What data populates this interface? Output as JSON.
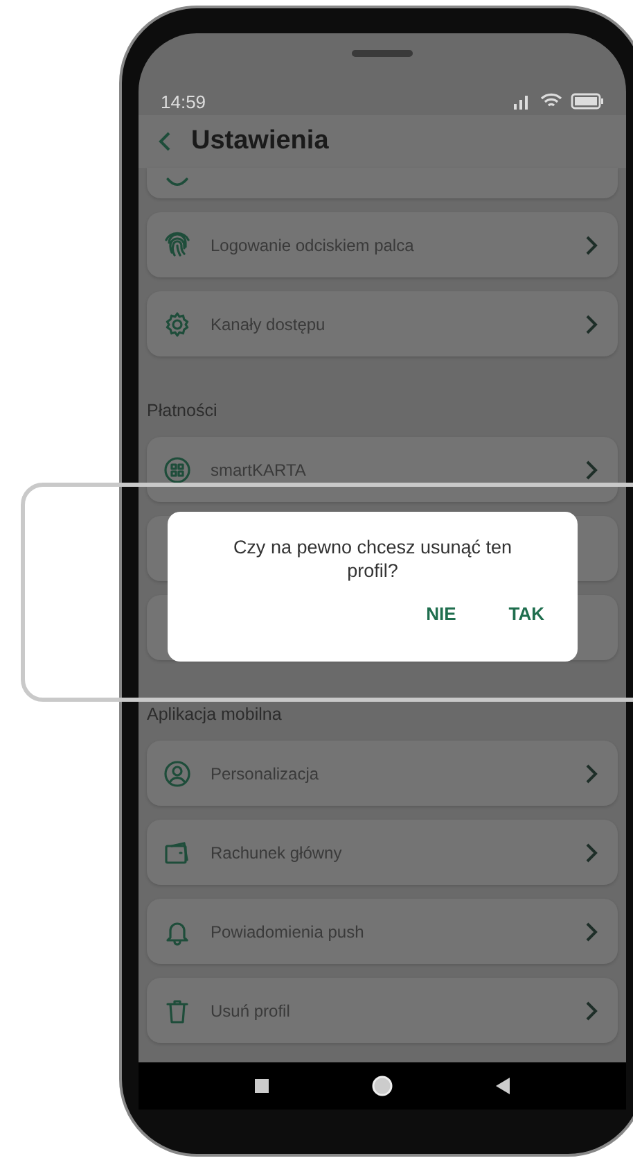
{
  "status_bar": {
    "time": "14:59"
  },
  "header": {
    "title": "Ustawienia"
  },
  "sections": [
    {
      "items": [
        {
          "kind": "cut"
        },
        {
          "kind": "row",
          "label": "Logowanie odciskiem palca"
        },
        {
          "kind": "row",
          "label": "Kanały dostępu"
        }
      ]
    },
    {
      "title": "Płatności",
      "items": [
        {
          "kind": "row",
          "label": "smartKARTA"
        },
        {
          "kind": "hidden"
        },
        {
          "kind": "hidden"
        }
      ]
    },
    {
      "title": "Aplikacja mobilna",
      "items": [
        {
          "kind": "row",
          "label": "Personalizacja"
        },
        {
          "kind": "row",
          "label": "Rachunek główny"
        },
        {
          "kind": "row",
          "label": "Powiadomienia push"
        },
        {
          "kind": "row",
          "label": "Usuń profil"
        }
      ]
    }
  ],
  "dialog": {
    "message": "Czy na pewno chcesz usunąć ten profil?",
    "buttons": [
      "NIE",
      "TAK"
    ]
  }
}
